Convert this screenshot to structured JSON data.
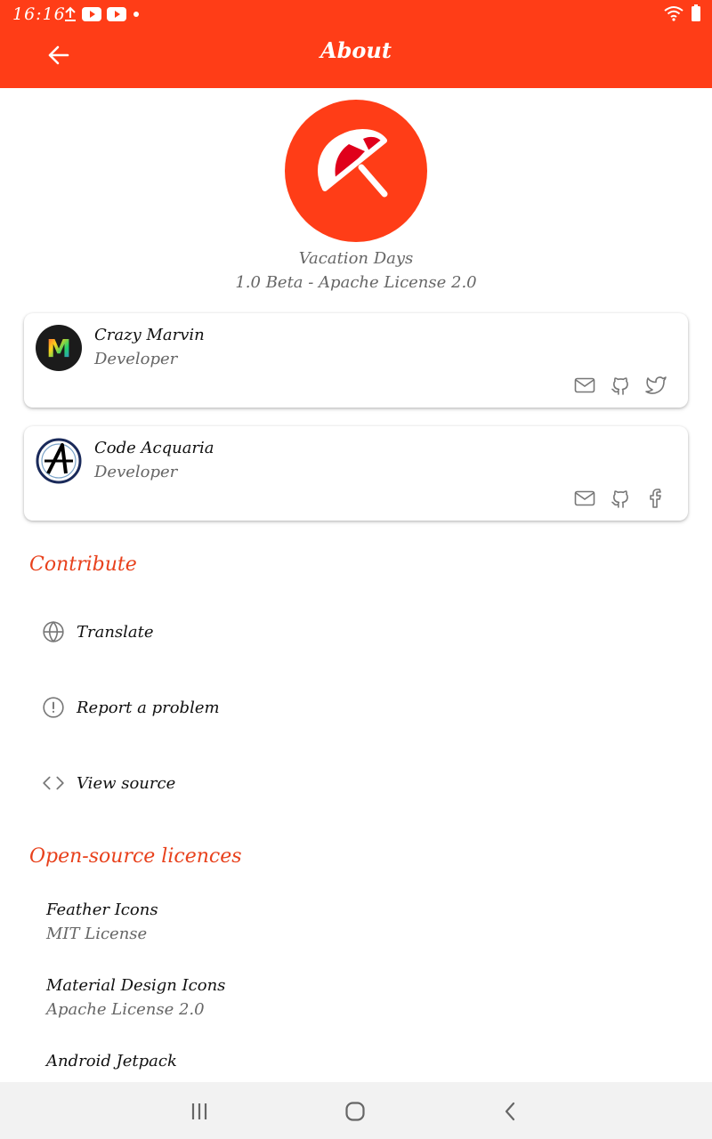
{
  "status_bar": {
    "time": "16:16"
  },
  "app_bar": {
    "title": "About"
  },
  "app_info": {
    "name": "Vacation Days",
    "version": "1.0 Beta - Apache License 2.0"
  },
  "developers": [
    {
      "name": "Crazy Marvin",
      "role": "Developer",
      "avatar_letter": "M",
      "links": [
        "email-icon",
        "github-icon",
        "twitter-icon"
      ]
    },
    {
      "name": "Code Acquaria",
      "role": "Developer",
      "links": [
        "email-icon",
        "github-icon",
        "facebook-icon"
      ]
    }
  ],
  "contribute": {
    "title": "Contribute",
    "items": [
      {
        "label": "Translate",
        "icon": "globe-icon"
      },
      {
        "label": "Report a problem",
        "icon": "alert-circle-icon"
      },
      {
        "label": "View source",
        "icon": "code-icon"
      }
    ]
  },
  "licences": {
    "title": "Open-source licences",
    "items": [
      {
        "name": "Feather Icons",
        "license": "MIT License"
      },
      {
        "name": "Material Design Icons",
        "license": "Apache License 2.0"
      },
      {
        "name": "Android Jetpack",
        "license": ""
      }
    ]
  },
  "colors": {
    "primary": "#ff3d17",
    "accent_text": "#e8411c",
    "secondary_text": "#666666"
  }
}
